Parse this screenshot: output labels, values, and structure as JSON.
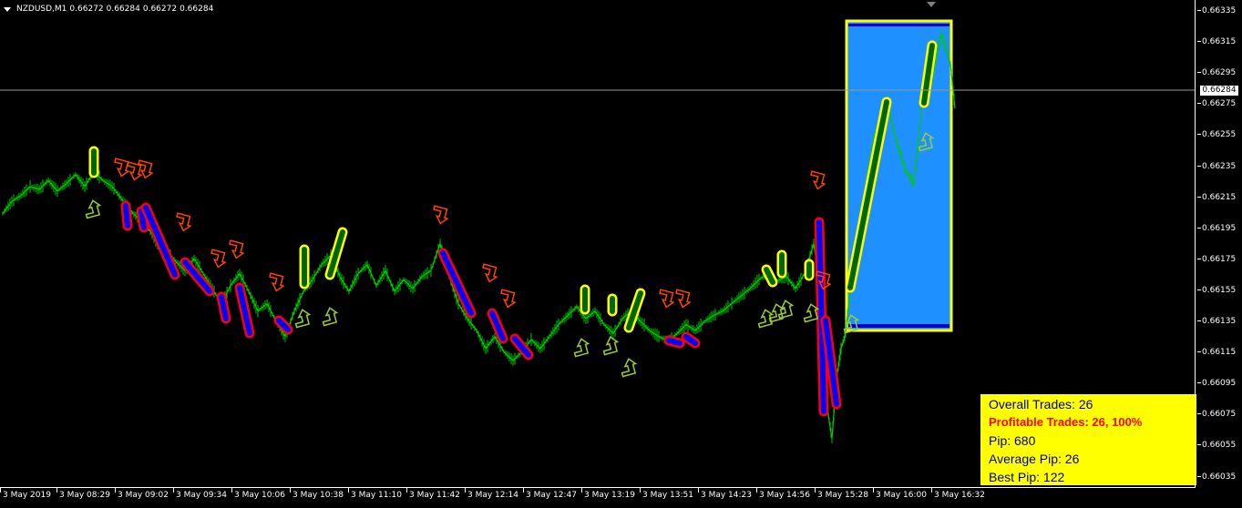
{
  "header": {
    "symbol": "NZDUSD,M1",
    "ohlc": [
      "0.66272",
      "0.66284",
      "0.66272",
      "0.66284"
    ]
  },
  "price_axis": {
    "ticks": [
      "0.66335",
      "0.66315",
      "0.66295",
      "0.66275",
      "0.66255",
      "0.66235",
      "0.66215",
      "0.66195",
      "0.66175",
      "0.66155",
      "0.66135",
      "0.66115",
      "0.66095",
      "0.66075",
      "0.66055",
      "0.66035"
    ],
    "current_price": "0.66284"
  },
  "time_axis": {
    "ticks": [
      "3 May 2019",
      "3 May 08:29",
      "3 May 09:02",
      "3 May 09:34",
      "3 May 10:06",
      "3 May 10:38",
      "3 May 11:10",
      "3 May 11:42",
      "3 May 12:14",
      "3 May 12:47",
      "3 May 13:19",
      "3 May 13:51",
      "3 May 14:23",
      "3 May 14:56",
      "3 May 15:28",
      "3 May 16:00",
      "3 May 16:32"
    ]
  },
  "stats": {
    "overall_trades": "Overall Trades: 26",
    "profitable_trades": "Profitable Trades: 26, 100%",
    "pip": "Pip: 680",
    "average_pip": "Average Pip: 26",
    "best_pip": "Best Pip: 122"
  },
  "colors": {
    "background": "#000000",
    "price_line": "#00cc00",
    "buy_signal": "#ffff00",
    "sell_signal": "#ff0000",
    "sell_fill": "#0000ff",
    "buy_arrow": "#99cc33",
    "sell_arrow": "#ff4400",
    "highlight_box": "#1e90ff",
    "stats_bg": "#ffff00"
  },
  "chart_data": {
    "type": "line",
    "symbol": "NZDUSD",
    "timeframe": "M1",
    "ylim": [
      0.66035,
      0.66345
    ],
    "x": [
      0,
      10,
      20,
      30,
      40,
      50,
      60,
      70,
      80,
      90,
      100,
      110,
      120,
      130,
      140,
      150,
      160,
      170,
      180,
      190,
      200,
      210,
      220,
      230,
      240,
      250,
      260,
      270,
      280,
      290,
      300,
      310,
      320,
      330,
      340,
      350,
      360,
      370,
      380,
      390,
      400,
      410,
      420,
      430,
      440,
      450,
      460,
      470,
      480,
      490,
      500,
      510,
      520,
      530,
      540,
      550,
      560,
      570,
      580,
      590,
      600,
      610,
      620,
      630,
      640,
      650,
      660,
      670,
      680,
      690,
      700,
      710,
      720,
      730,
      740,
      750,
      760,
      770,
      780,
      790,
      800,
      810,
      820,
      830,
      840,
      850,
      860,
      870,
      880,
      890,
      900,
      905,
      910,
      915,
      920,
      925,
      930,
      940,
      950,
      960,
      970,
      980,
      990,
      1000,
      1010,
      1020,
      1030,
      1040,
      1045
    ],
    "values": [
      0.6621,
      0.66218,
      0.66222,
      0.66228,
      0.66226,
      0.66232,
      0.66225,
      0.6623,
      0.66236,
      0.66228,
      0.66238,
      0.66232,
      0.66228,
      0.6622,
      0.66212,
      0.66206,
      0.662,
      0.6619,
      0.66185,
      0.66178,
      0.66172,
      0.6618,
      0.6617,
      0.6616,
      0.6615,
      0.66162,
      0.6617,
      0.66158,
      0.66145,
      0.6615,
      0.66138,
      0.66128,
      0.66145,
      0.66158,
      0.66166,
      0.66176,
      0.66182,
      0.66168,
      0.66158,
      0.6617,
      0.66176,
      0.66162,
      0.66172,
      0.66158,
      0.66166,
      0.6616,
      0.66168,
      0.66172,
      0.6619,
      0.66168,
      0.6615,
      0.6614,
      0.66132,
      0.6612,
      0.66128,
      0.66118,
      0.66112,
      0.66118,
      0.66126,
      0.6612,
      0.66128,
      0.66136,
      0.66142,
      0.66148,
      0.6614,
      0.66145,
      0.66136,
      0.6613,
      0.6614,
      0.66145,
      0.66138,
      0.66132,
      0.66128,
      0.66125,
      0.6613,
      0.66136,
      0.66132,
      0.66138,
      0.66142,
      0.66145,
      0.6615,
      0.66155,
      0.6616,
      0.66166,
      0.6617,
      0.66165,
      0.66168,
      0.6616,
      0.6617,
      0.6619,
      0.6615,
      0.6608,
      0.6606,
      0.661,
      0.6612,
      0.6613,
      0.6616,
      0.662,
      0.6624,
      0.6627,
      0.66285,
      0.6626,
      0.6624,
      0.6623,
      0.6629,
      0.663,
      0.6633,
      0.6631,
      0.6628
    ]
  }
}
